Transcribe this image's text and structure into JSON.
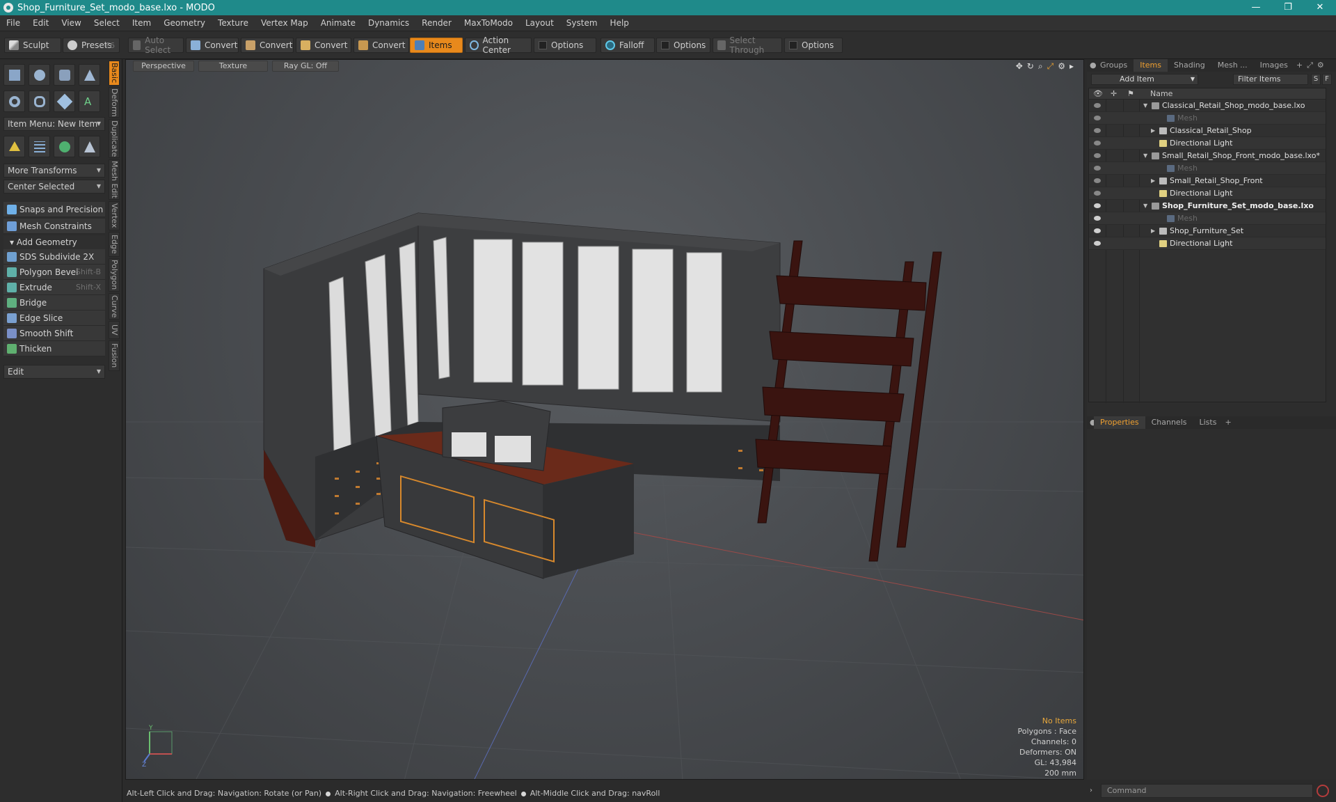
{
  "window": {
    "title": "Shop_Furniture_Set_modo_base.lxo - MODO",
    "controls": [
      "—",
      "❐",
      "✕"
    ]
  },
  "menu": [
    "File",
    "Edit",
    "View",
    "Select",
    "Item",
    "Geometry",
    "Texture",
    "Vertex Map",
    "Animate",
    "Dynamics",
    "Render",
    "MaxToModo",
    "Layout",
    "System",
    "Help"
  ],
  "toolbar": {
    "sculpt": "Sculpt",
    "presets": "Presets",
    "presets_key": "F6",
    "auto_select": "Auto Select",
    "convert1": "Convert",
    "convert2": "Convert",
    "convert3": "Convert",
    "convert4": "Convert",
    "items": "Items",
    "action_center": "Action Center",
    "options1": "Options",
    "falloff": "Falloff",
    "options2": "Options",
    "select_through": "Select Through",
    "options3": "Options"
  },
  "left": {
    "item_menu": "Item Menu: New Item",
    "more_transforms": "More Transforms",
    "center_selected": "Center Selected",
    "snaps": "Snaps and Precision",
    "mesh_constraints": "Mesh Constraints",
    "add_geometry": "Add Geometry",
    "tools": [
      {
        "label": "SDS Subdivide 2X",
        "key": ""
      },
      {
        "label": "Polygon Bevel",
        "key": "Shift-B"
      },
      {
        "label": "Extrude",
        "key": "Shift-X"
      },
      {
        "label": "Bridge",
        "key": ""
      },
      {
        "label": "Edge Slice",
        "key": ""
      },
      {
        "label": "Smooth Shift",
        "key": ""
      },
      {
        "label": "Thicken",
        "key": ""
      }
    ],
    "edit_dropdown": "Edit",
    "side_tabs": [
      "Basic",
      "Deform",
      "Duplicate",
      "Mesh Edit",
      "Vertex",
      "Edge",
      "Polygon",
      "Curve",
      "UV",
      "Fusion"
    ]
  },
  "viewport": {
    "tabs": [
      "Perspective",
      "Texture",
      "Ray GL: Off"
    ],
    "info": {
      "selection": "No Items",
      "polygons": "Polygons : Face",
      "channels": "Channels: 0",
      "deformers": "Deformers: ON",
      "gl": "GL: 43,984",
      "scale": "200 mm"
    },
    "axis": {
      "y": "Y",
      "z": "Z"
    }
  },
  "right": {
    "tabs": [
      "Groups",
      "Items",
      "Shading",
      "Mesh ...",
      "Images"
    ],
    "add_item": "Add Item",
    "filter": "Filter Items",
    "s_btn": "S",
    "f_btn": "F",
    "column_name": "Name",
    "tree": [
      {
        "name": "Classical_Retail_Shop_modo_base.lxo",
        "indent": 0,
        "type": "scene",
        "arrow": "▼"
      },
      {
        "name": "Mesh",
        "indent": 2,
        "type": "mesh",
        "dim": true
      },
      {
        "name": "Classical_Retail_Shop",
        "indent": 1,
        "type": "locator",
        "arrow": "▶"
      },
      {
        "name": "Directional Light",
        "indent": 1,
        "type": "light"
      },
      {
        "name": "Small_Retail_Shop_Front_modo_base.lxo*",
        "indent": 0,
        "type": "scene",
        "arrow": "▼"
      },
      {
        "name": "Mesh",
        "indent": 2,
        "type": "mesh",
        "dim": true
      },
      {
        "name": "Small_Retail_Shop_Front",
        "indent": 1,
        "type": "locator",
        "arrow": "▶"
      },
      {
        "name": "Directional Light",
        "indent": 1,
        "type": "light"
      },
      {
        "name": "Shop_Furniture_Set_modo_base.lxo",
        "indent": 0,
        "type": "scene",
        "arrow": "▼",
        "bold": true
      },
      {
        "name": "Mesh",
        "indent": 2,
        "type": "mesh",
        "dim": true
      },
      {
        "name": "Shop_Furniture_Set",
        "indent": 1,
        "type": "locator",
        "arrow": "▶"
      },
      {
        "name": "Directional Light",
        "indent": 1,
        "type": "light"
      }
    ],
    "lower_tabs": [
      "Properties",
      "Channels",
      "Lists"
    ],
    "command_placeholder": "Command"
  },
  "status": {
    "hint1": "Alt-Left Click and Drag: Navigation: Rotate (or Pan)",
    "hint2": "Alt-Right Click and Drag: Navigation: Freewheel",
    "hint3": "Alt-Middle Click and Drag: navRoll"
  },
  "colors": {
    "accent": "#e8891c",
    "titlebar": "#1f8a8a",
    "wood": "#4a1a12",
    "cabinet": "#3a3b3d"
  }
}
